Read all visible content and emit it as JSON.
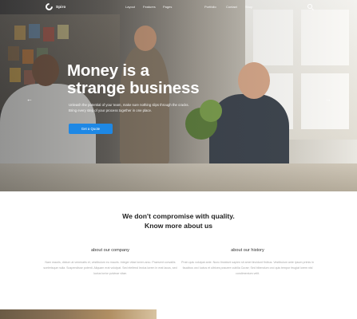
{
  "brand": {
    "name": "Spiro"
  },
  "nav": {
    "links": [
      "Layout",
      "Features",
      "Pages",
      "Portfolio",
      "Contact",
      "Shop"
    ]
  },
  "hero": {
    "title_line1": "Money is a",
    "title_line2": "strange business",
    "description": "Unleash the potential of your team, make sure nothing slips through the cracks. Bring every step of your process together in one place.",
    "button_label": "Get a Quote",
    "prev_arrow": "←",
    "next_arrow": "→"
  },
  "section": {
    "heading_line1": "We don't compromise with quality.",
    "heading_line2": "Know more about us",
    "columns": [
      {
        "title": "about our company",
        "text": "Nam mauris, dictum at venenatis et, vestibulum eu mauris. Integer vitae lorem arcu. Praesent convallis scelerisque nulla. Suspendisse potenti. Aliquam erat volutpat. Sed eleifend lectus lorem in erat lacus, sed luctus tortor pulvinar vitae."
      },
      {
        "title": "about our history",
        "text": "Proin quis volutpat ante. Nunc tincidunt sapien sit amet tincidunt finibus. Vestibulum ante ipsum primis in faucibus orci luctus et ultrices posuere cubilia Curae; Sed bibendum orci quis tempor feugiat lorem nisl condimentum velit."
      }
    ]
  },
  "colors": {
    "accent": "#1e88e5",
    "heading": "#222222",
    "body_text": "#a5a5a5"
  }
}
